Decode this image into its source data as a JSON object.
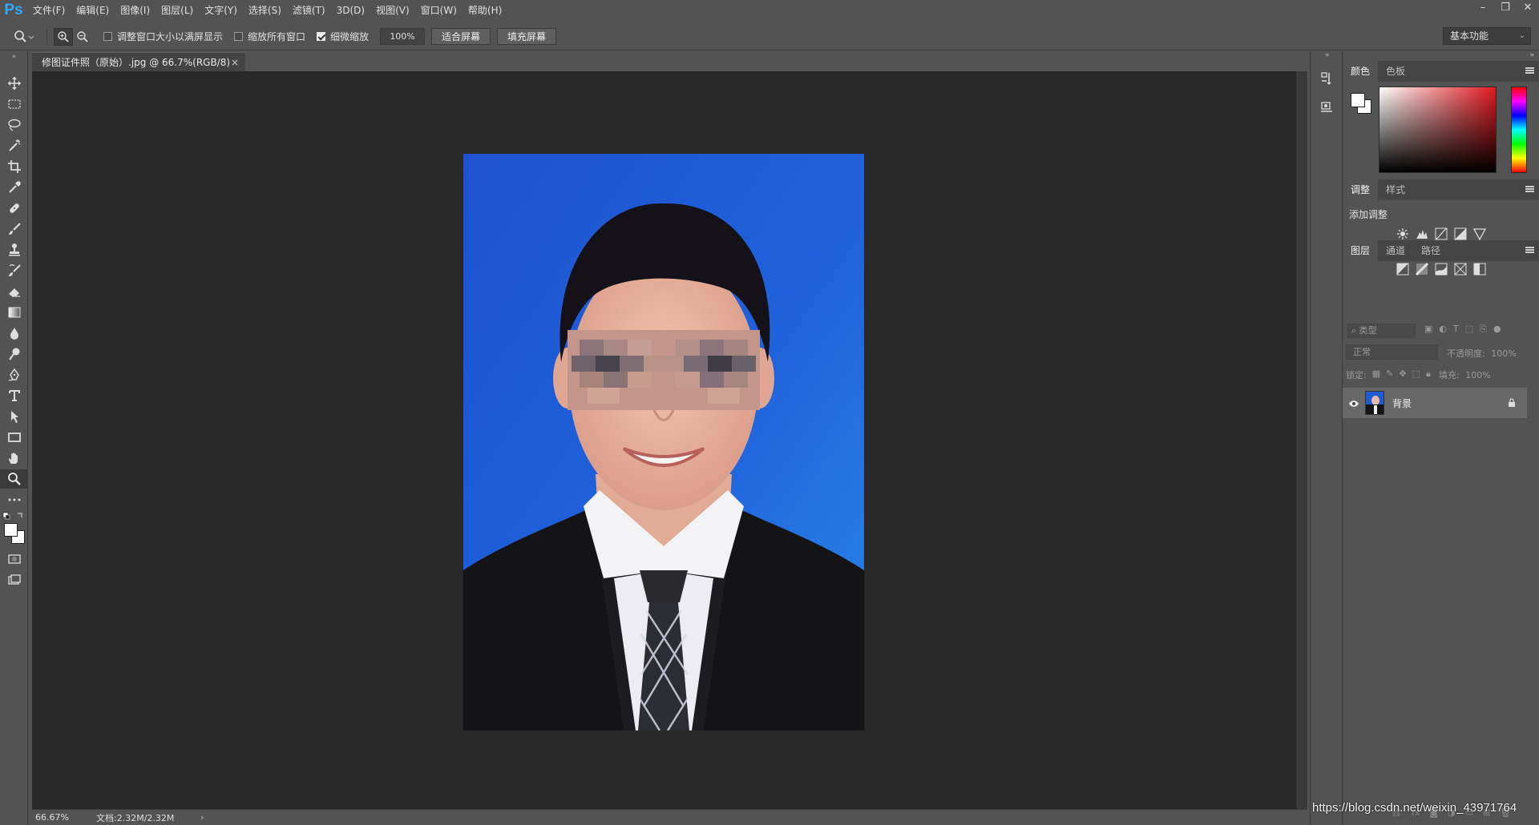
{
  "app": {
    "logo": "Ps"
  },
  "menu": [
    "文件(F)",
    "编辑(E)",
    "图像(I)",
    "图层(L)",
    "文字(Y)",
    "选择(S)",
    "滤镜(T)",
    "3D(D)",
    "视图(V)",
    "窗口(W)",
    "帮助(H)"
  ],
  "options": {
    "resize_windows": "调整窗口大小以满屏显示",
    "resize_windows_checked": false,
    "zoom_all": "缩放所有窗口",
    "zoom_all_checked": false,
    "scrubby_zoom": "细微缩放",
    "scrubby_zoom_checked": true,
    "zoom_value": "100%",
    "fit_screen": "适合屏幕",
    "fill_screen": "填充屏幕",
    "workspace": "基本功能"
  },
  "document": {
    "tab_title": "修图证件照（原始）.jpg @ 66.7%(RGB/8)",
    "close": "×"
  },
  "status": {
    "zoom": "66.67%",
    "doc_size": "文档:2.32M/2.32M",
    "arrow": "›"
  },
  "panels": {
    "color_tabs": [
      "颜色",
      "色板"
    ],
    "adjust_tabs": [
      "调整",
      "样式"
    ],
    "add_adjustment": "添加调整",
    "layers_tabs": [
      "图层",
      "通道",
      "路径"
    ],
    "kind_filter": "类型",
    "blend_mode": "正常",
    "opacity_label": "不透明度:",
    "opacity_value": "100%",
    "lock_label": "锁定:",
    "fill_label": "填充:",
    "fill_value": "100%",
    "layer_name": "背景"
  },
  "colors": {
    "foreground": "#ffffff",
    "background": "#ffffff",
    "photo_bg": "#1d5cd6"
  },
  "watermark": "https://blog.csdn.net/weixin_43971764"
}
